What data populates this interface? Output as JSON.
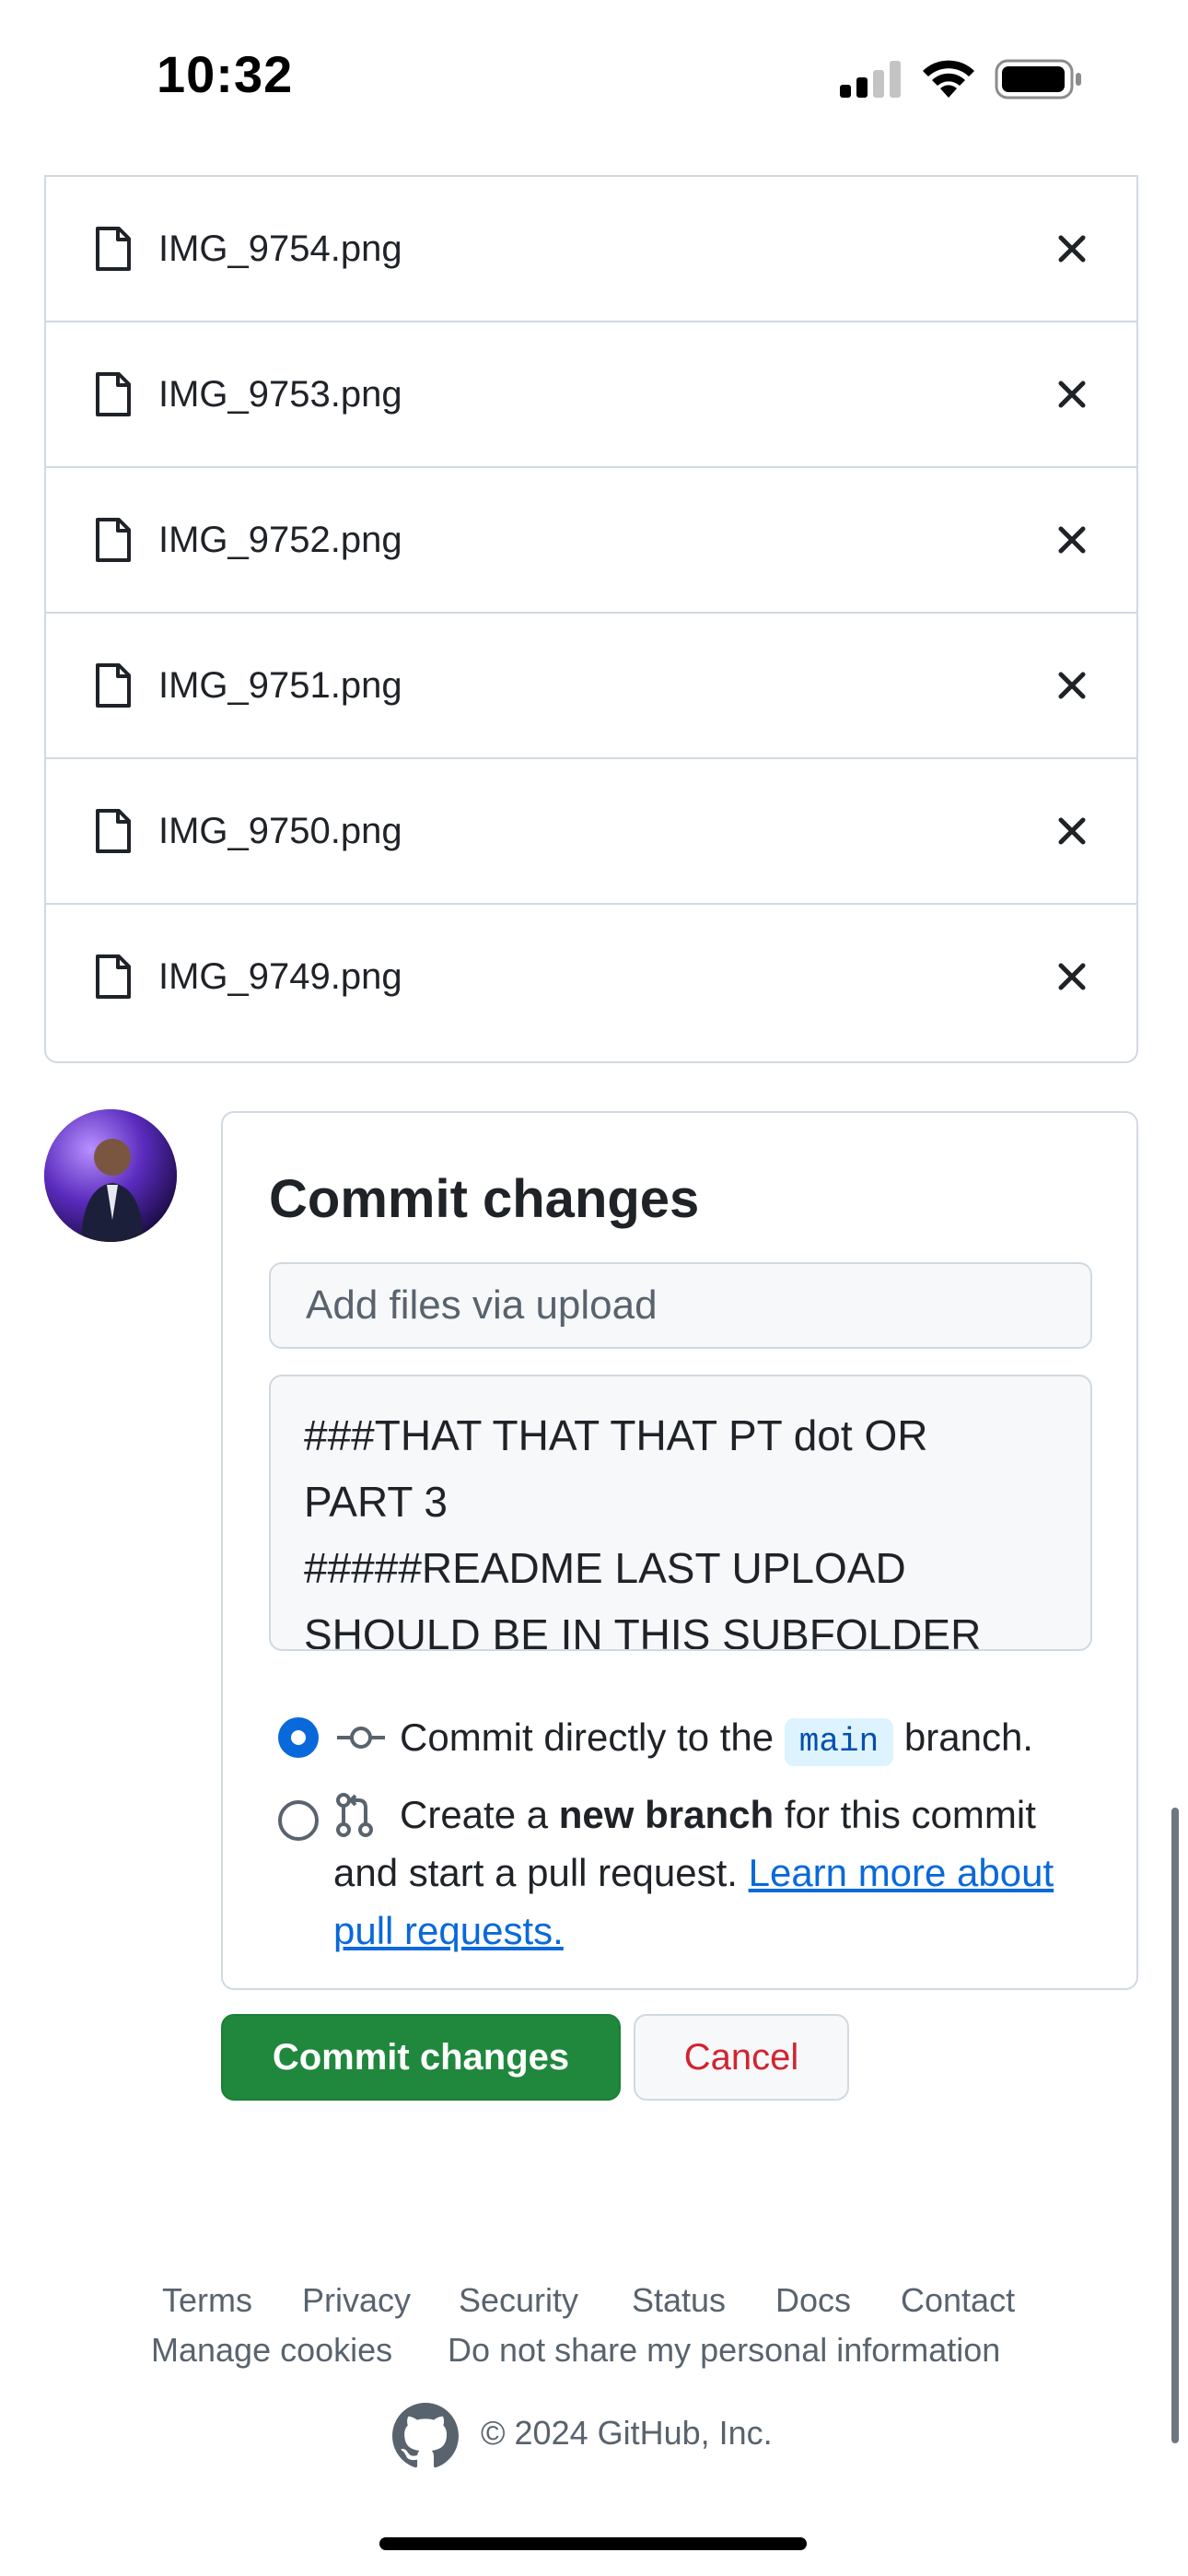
{
  "status_bar": {
    "time": "10:32"
  },
  "files": [
    {
      "name": "IMG_9754.png"
    },
    {
      "name": "IMG_9753.png"
    },
    {
      "name": "IMG_9752.png"
    },
    {
      "name": "IMG_9751.png"
    },
    {
      "name": "IMG_9750.png"
    },
    {
      "name": "IMG_9749.png"
    }
  ],
  "commit": {
    "title": "Commit changes",
    "summary_placeholder": "Add files via upload",
    "description": "###THAT THAT THAT PT dot OR\nPART 3\n#####README LAST UPLOAD\nSHOULD BE IN THIS SUBFOLDER",
    "option_direct": {
      "prefix": "Commit directly to the",
      "branch": "main",
      "suffix": "branch.",
      "selected": true
    },
    "option_new_branch": {
      "prefix": "Create a",
      "bold": "new branch",
      "line1_rest": "for this commit",
      "line2": "and start a pull request.",
      "link_part1": "Learn more about",
      "link_part2": "pull requests.",
      "selected": false
    }
  },
  "buttons": {
    "commit": "Commit changes",
    "cancel": "Cancel"
  },
  "footer": {
    "links_row1": [
      "Terms",
      "Privacy",
      "Security",
      "Status",
      "Docs",
      "Contact"
    ],
    "links_row2": [
      "Manage cookies",
      "Do not share my personal information"
    ],
    "copyright": "© 2024 GitHub, Inc."
  },
  "colors": {
    "primary_green": "#1f883d",
    "danger_red": "#d1242f",
    "link_blue": "#0969da",
    "border": "#d1d9e0"
  },
  "icons": [
    "signal-icon",
    "wifi-icon",
    "battery-icon",
    "file-icon",
    "close-icon",
    "commit-icon",
    "pull-request-icon",
    "github-logo-icon"
  ]
}
